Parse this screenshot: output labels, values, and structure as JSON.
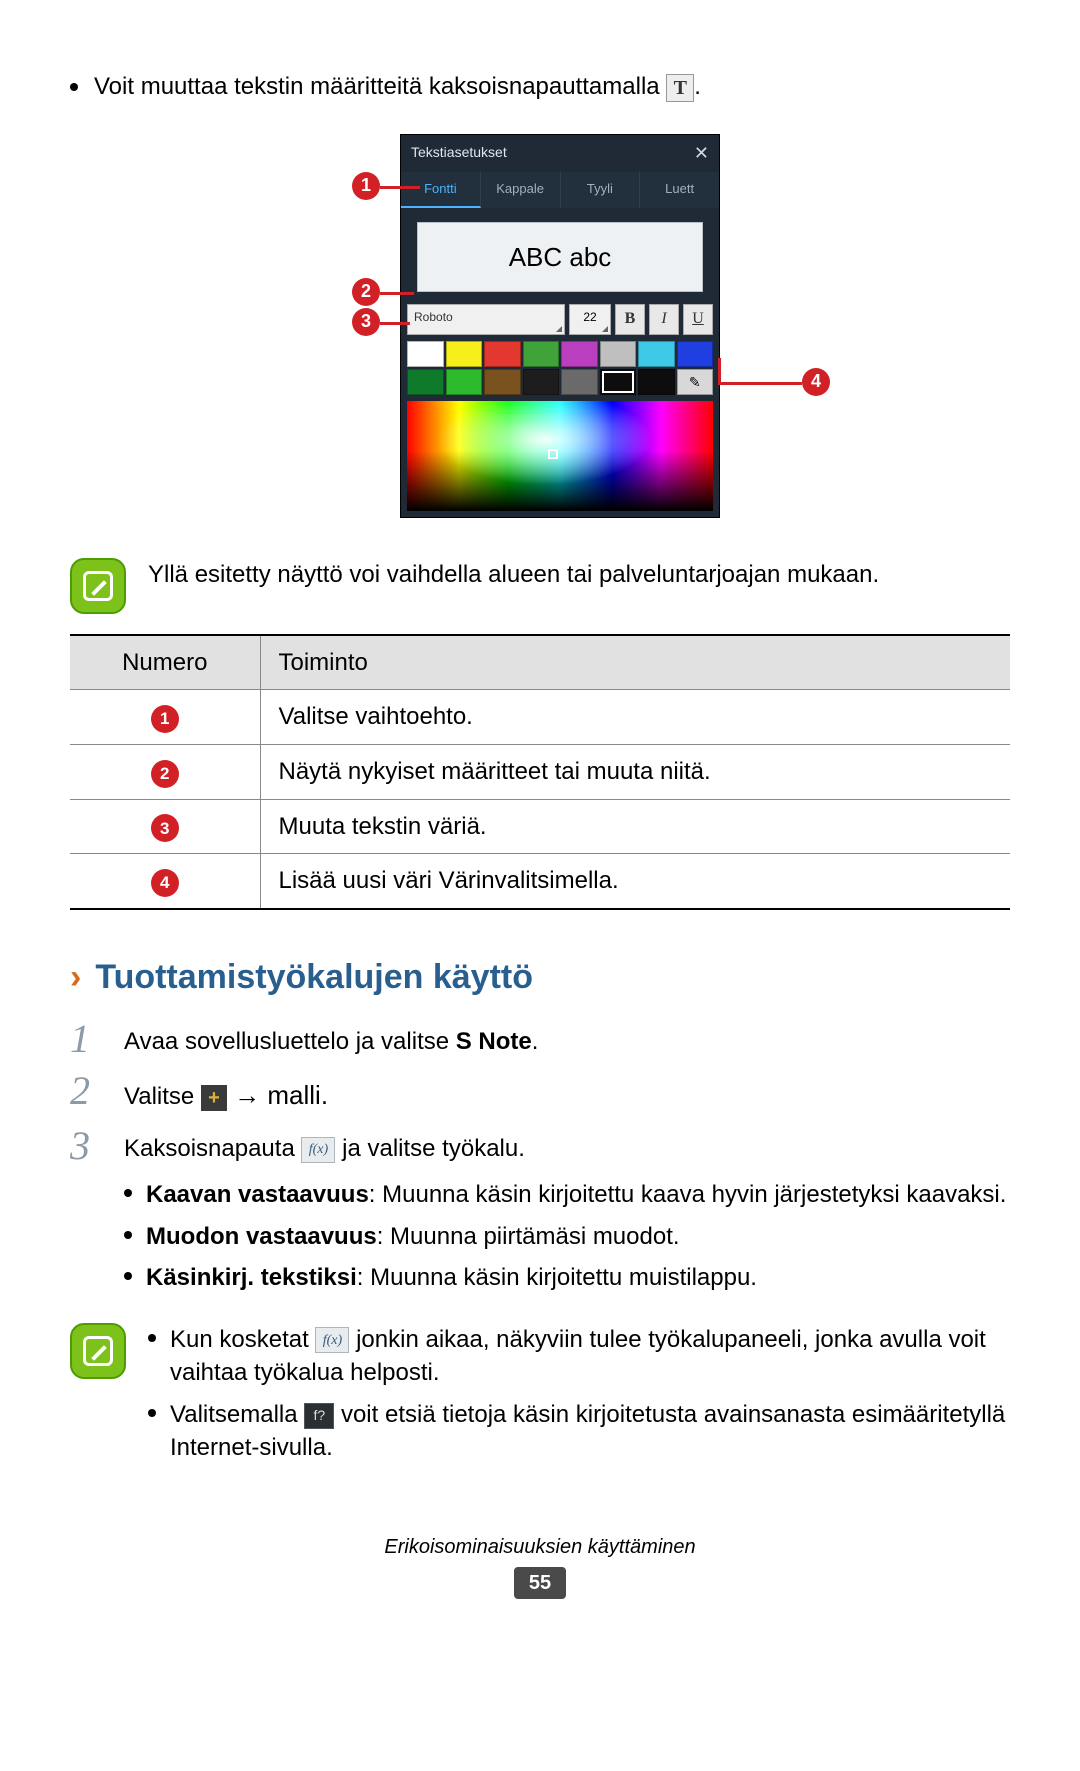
{
  "intro": {
    "text_before": "Voit muuttaa tekstin määritteitä kaksoisnapauttamalla ",
    "text_after": "."
  },
  "panel": {
    "title": "Tekstiasetukset",
    "tabs": [
      "Fontti",
      "Kappale",
      "Tyyli",
      "Luett"
    ],
    "preview": "ABC abc",
    "font": "Roboto",
    "size": "22",
    "style_b": "B",
    "style_i": "I",
    "style_u": "U"
  },
  "callouts": {
    "c1": "1",
    "c2": "2",
    "c3": "3",
    "c4": "4"
  },
  "note1": "Yllä esitetty näyttö voi vaihdella alueen tai palveluntarjoajan mukaan.",
  "table": {
    "head_num": "Numero",
    "head_func": "Toiminto",
    "rows": [
      {
        "n": "1",
        "t": "Valitse vaihtoehto."
      },
      {
        "n": "2",
        "t": "Näytä nykyiset määritteet tai muuta niitä."
      },
      {
        "n": "3",
        "t": "Muuta tekstin väriä."
      },
      {
        "n": "4",
        "t": "Lisää uusi väri Värinvalitsimella."
      }
    ]
  },
  "section": {
    "title": "Tuottamistyökalujen käyttö"
  },
  "steps": {
    "s1a": "Avaa sovellusluettelo ja valitse ",
    "s1b": "S Note",
    "s1c": ".",
    "s2a": "Valitse ",
    "s2b": " → malli.",
    "s3a": "Kaksoisnapauta ",
    "s3b": " ja valitse työkalu."
  },
  "subs": {
    "a1": "Kaavan vastaavuus",
    "a2": ": Muunna käsin kirjoitettu kaava hyvin järjestetyksi kaavaksi.",
    "b1": "Muodon vastaavuus",
    "b2": ": Muunna piirtämäsi muodot.",
    "c1": "Käsinkirj. tekstiksi",
    "c2": ": Muunna käsin kirjoitettu muistilappu."
  },
  "note2": {
    "l1a": "Kun kosketat ",
    "l1b": " jonkin aikaa, näkyviin tulee työkalupaneeli, jonka avulla voit vaihtaa työkalua helposti.",
    "l2a": "Valitsemalla ",
    "l2b": " voit etsiä tietoja käsin kirjoitetusta avainsanasta esimääritetyllä Internet-sivulla."
  },
  "footer": {
    "chapter": "Erikoisominaisuuksien käyttäminen",
    "page": "55"
  },
  "swatch_colors": [
    "#ffffff",
    "#f6ef1c",
    "#e3382f",
    "#3fa33a",
    "#b93fbf",
    "#bfbfbf",
    "#3fc9e9",
    "#1f3fe0",
    "#0e7a2a",
    "#2dbb2d",
    "#7a521f",
    "#1d1d1d",
    "#6a6a6a",
    "#0d0d0d",
    "#0d0d0d",
    "#d8d8d8"
  ]
}
